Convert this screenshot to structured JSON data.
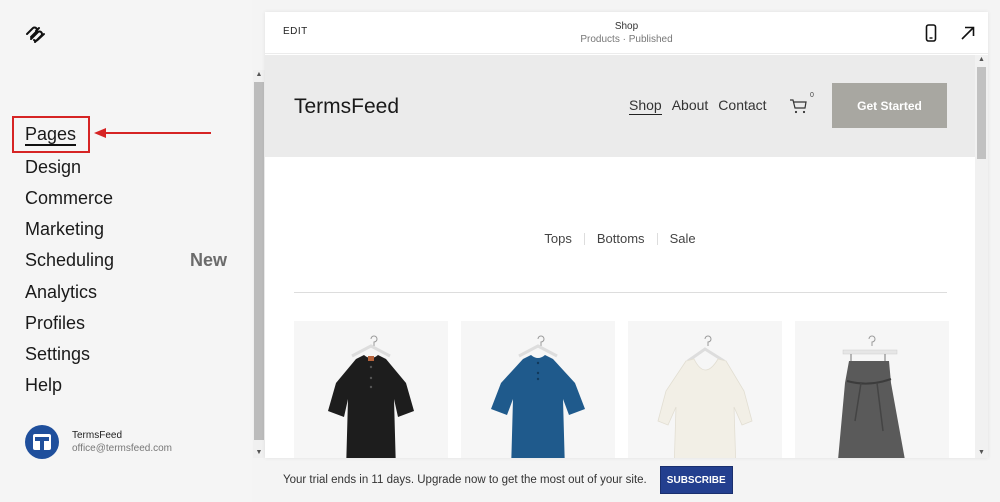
{
  "sidebar": {
    "logo_icon": "squarespace-logo-icon",
    "items": [
      {
        "label": "Pages",
        "active": true,
        "badge": ""
      },
      {
        "label": "Design",
        "badge": ""
      },
      {
        "label": "Commerce",
        "badge": ""
      },
      {
        "label": "Marketing",
        "badge": ""
      },
      {
        "label": "Scheduling",
        "badge": "New"
      },
      {
        "label": "Analytics",
        "badge": ""
      },
      {
        "label": "Profiles",
        "badge": ""
      },
      {
        "label": "Settings",
        "badge": ""
      },
      {
        "label": "Help",
        "badge": ""
      }
    ],
    "account": {
      "name": "TermsFeed",
      "email": "office@termsfeed.com"
    },
    "annotation": {
      "color": "#d62424"
    }
  },
  "preview_bar": {
    "edit_label": "EDIT",
    "page_title": "Shop",
    "page_subtitle": "Products · Published",
    "icons": [
      "mobile-view-icon",
      "open-external-icon"
    ]
  },
  "site": {
    "logo": "TermsFeed",
    "nav": [
      {
        "label": "Shop",
        "active": true
      },
      {
        "label": "About"
      },
      {
        "label": "Contact"
      }
    ],
    "cart_count": "0",
    "cta_label": "Get Started",
    "categories": [
      "Tops",
      "Bottoms",
      "Sale"
    ],
    "products": [
      {
        "name": "black-linen-top",
        "color": "#1c1c1c"
      },
      {
        "name": "blue-linen-top",
        "color": "#1f5a8c"
      },
      {
        "name": "white-draped-top",
        "color": "#f2efe6"
      },
      {
        "name": "grey-wrap-skirt",
        "color": "#5a5a5a"
      }
    ]
  },
  "trial": {
    "message": "Your trial ends in 11 days. Upgrade now to get the most out of your site.",
    "button_label": "SUBSCRIBE"
  },
  "colors": {
    "subscribe": "#233f8f",
    "cta": "#a8a7a1",
    "avatar": "#1f4f9c"
  }
}
